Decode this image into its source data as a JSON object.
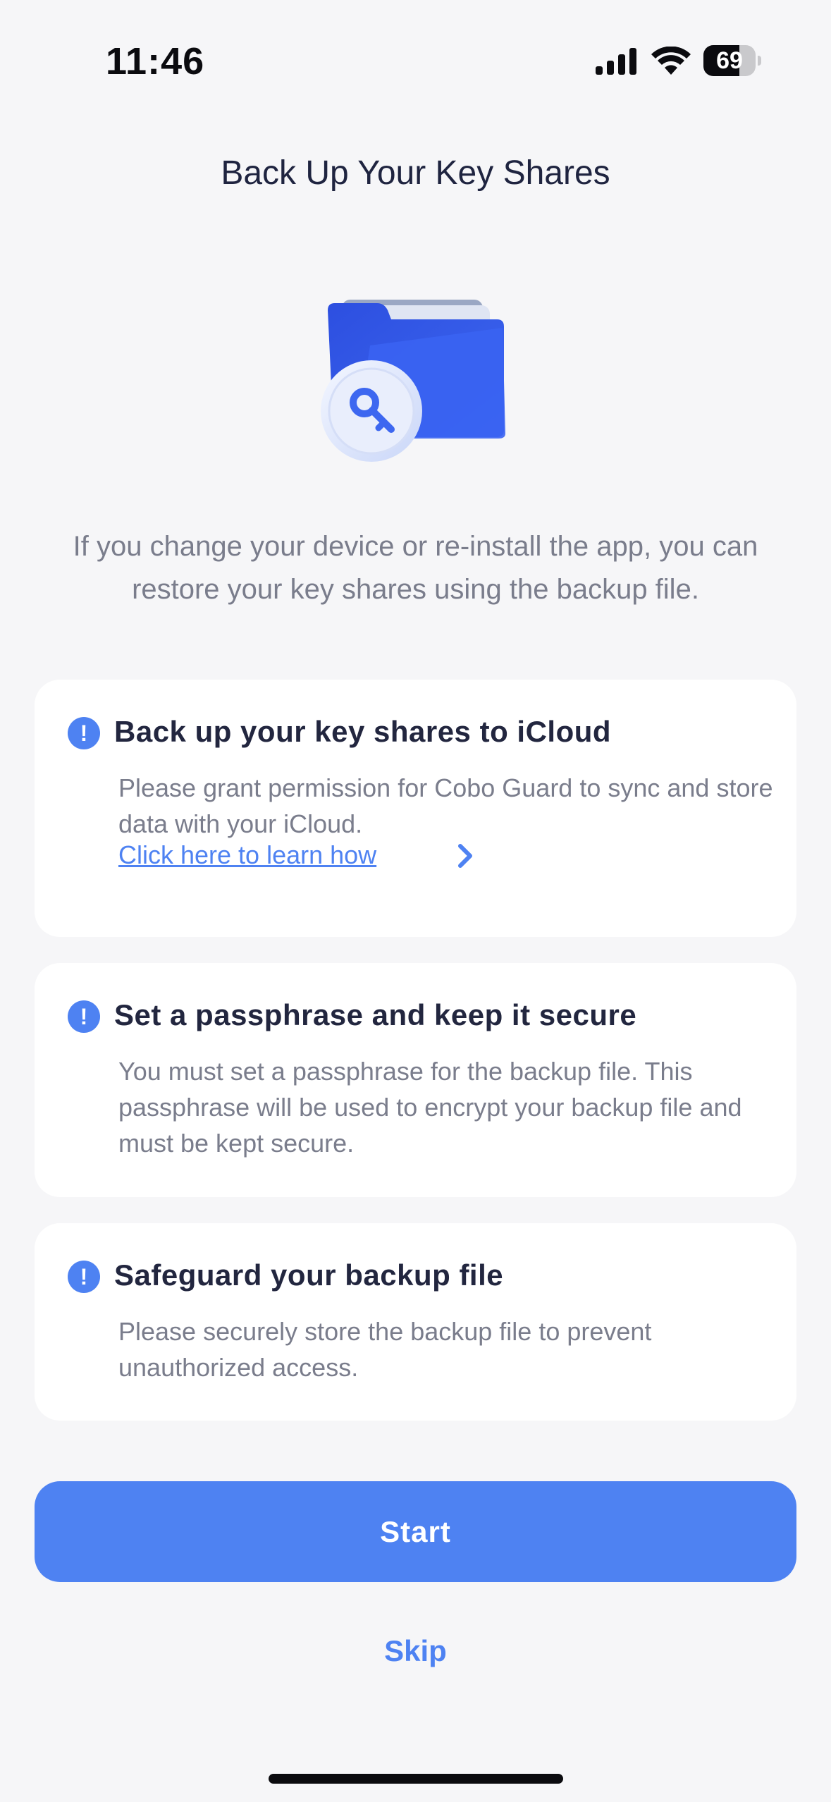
{
  "status_bar": {
    "time": "11:46",
    "battery_level": "69",
    "battery_fraction": 0.69,
    "icons": [
      "signal-icon",
      "wifi-icon",
      "battery-icon"
    ]
  },
  "header": {
    "title": "Back Up Your Key Shares"
  },
  "illustration": {
    "icon": "folder-key-icon"
  },
  "intro": {
    "text": "If you change your device or re-install the app, you can restore your key shares using the backup file."
  },
  "cards": [
    {
      "icon": "alert-icon",
      "title": "Back up your key shares to iCloud",
      "body": "Please grant permission for Cobo Guard to sync and store data with your iCloud.",
      "link_label": "Click here to learn how"
    },
    {
      "icon": "alert-icon",
      "title": "Set a passphrase and keep it secure",
      "body": "You must set a passphrase for the backup file. This passphrase will be used to encrypt your backup file and must be kept secure."
    },
    {
      "icon": "alert-icon",
      "title": "Safeguard your backup file",
      "body": "Please securely store the backup file to prevent unauthorized access."
    }
  ],
  "actions": {
    "start_label": "Start",
    "skip_label": "Skip"
  },
  "colors": {
    "accent": "#4e82f2",
    "background": "#f6f6f8",
    "card": "#ffffff",
    "title_text": "#1f2440",
    "body_text": "#7a7d8c"
  }
}
